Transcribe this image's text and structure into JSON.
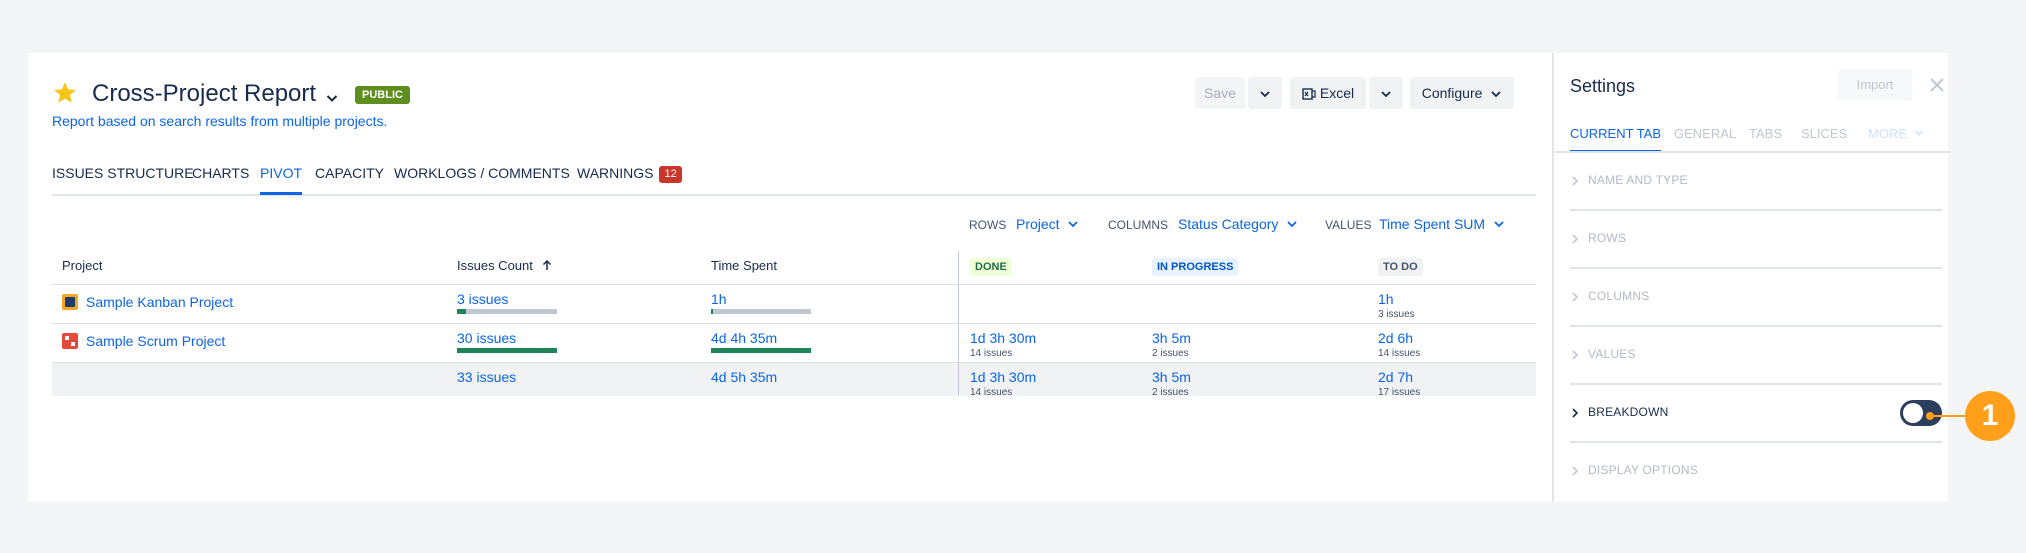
{
  "report": {
    "title": "Cross-Project Report",
    "visibility_badge": "PUBLIC",
    "subtitle": "Report based on search results from multiple projects."
  },
  "toolbar": {
    "save_label": "Save",
    "excel_label": "Excel",
    "configure_label": "Configure"
  },
  "tabs": [
    {
      "label": "ISSUES STRUCTURE"
    },
    {
      "label": "CHARTS"
    },
    {
      "label": "PIVOT",
      "active": true
    },
    {
      "label": "CAPACITY"
    },
    {
      "label": "WORKLOGS / COMMENTS"
    },
    {
      "label": "WARNINGS",
      "count": "12"
    }
  ],
  "selectors": {
    "rows_label": "ROWS",
    "rows_value": "Project",
    "columns_label": "COLUMNS",
    "columns_value": "Status Category",
    "values_label": "VALUES",
    "values_value": "Time Spent SUM"
  },
  "table": {
    "headers": {
      "project": "Project",
      "issues_count": "Issues Count",
      "time_spent": "Time Spent"
    },
    "status_columns": [
      {
        "label": "DONE",
        "color": "#e3fcef",
        "text_color": "#216e4e",
        "bg": "#efffd6"
      },
      {
        "label": "IN PROGRESS",
        "color": "#deebff",
        "text_color": "#0055cc"
      },
      {
        "label": "TO DO",
        "color": "#f1f2f4",
        "text_color": "#44546f"
      }
    ],
    "rows": [
      {
        "project": "Sample Kanban Project",
        "project_icon": "kanban-project-icon",
        "issues": "3 issues",
        "issues_fraction": 0.09,
        "time_spent": "1h",
        "time_fraction": 0.02,
        "done": {
          "value": "",
          "sub": ""
        },
        "in_progress": {
          "value": "",
          "sub": ""
        },
        "todo": {
          "value": "1h",
          "sub": "3 issues"
        }
      },
      {
        "project": "Sample Scrum Project",
        "project_icon": "scrum-project-icon",
        "issues": "30 issues",
        "issues_fraction": 1.0,
        "time_spent": "4d 4h 35m",
        "time_fraction": 1.0,
        "done": {
          "value": "1d 3h 30m",
          "sub": "14 issues"
        },
        "in_progress": {
          "value": "3h 5m",
          "sub": "2 issues"
        },
        "todo": {
          "value": "2d 6h",
          "sub": "14 issues"
        }
      }
    ],
    "total": {
      "issues": "33 issues",
      "time_spent": "4d 5h 35m",
      "done": {
        "value": "1d 3h 30m",
        "sub": "14 issues"
      },
      "in_progress": {
        "value": "3h 5m",
        "sub": "2 issues"
      },
      "todo": {
        "value": "2d 7h",
        "sub": "17 issues"
      }
    }
  },
  "settings": {
    "title": "Settings",
    "import_label": "Import",
    "tabs": [
      {
        "label": "CURRENT TAB",
        "active": true
      },
      {
        "label": "GENERAL"
      },
      {
        "label": "TABS"
      },
      {
        "label": "SLICES"
      },
      {
        "label": "MORE"
      }
    ],
    "sections": [
      {
        "label": "NAME AND TYPE"
      },
      {
        "label": "ROWS"
      },
      {
        "label": "COLUMNS"
      },
      {
        "label": "VALUES"
      },
      {
        "label": "BREAKDOWN",
        "enabled": true,
        "toggle_on": false
      },
      {
        "label": "DISPLAY OPTIONS"
      }
    ]
  },
  "callout_number": "1",
  "colors": {
    "accent": "#0c66e4",
    "bar_fill": "#1f845a",
    "bar_track": "#c1c7d0",
    "callout": "#ff9f1a",
    "public_badge": "#5e8f1e",
    "warnings_badge": "#c9372c"
  }
}
